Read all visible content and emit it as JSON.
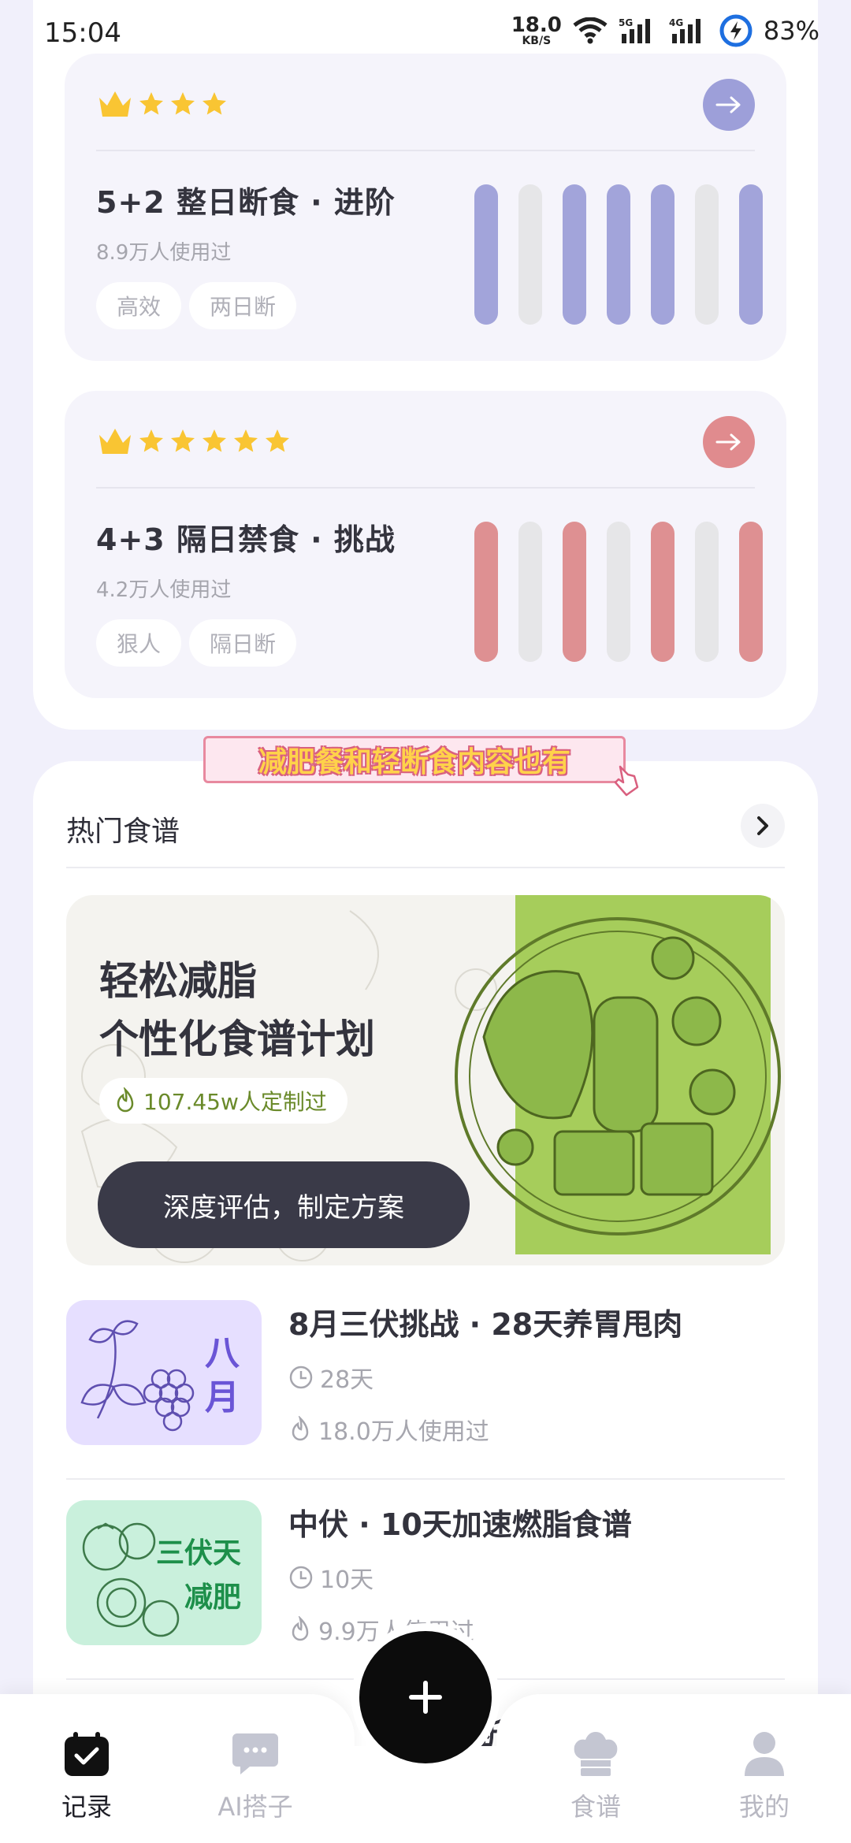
{
  "status_bar": {
    "time": "15:04",
    "net_speed": "18.0",
    "net_unit": "KB/S",
    "sig5g": "5G",
    "sig4g": "4G",
    "battery": "83%"
  },
  "plans": [
    {
      "crowns": 1,
      "stars": 3,
      "title": "5+2 整日断食 · 进阶",
      "users": "8.9万人使用过",
      "tags": [
        "高效",
        "两日断"
      ],
      "accent": "#a2a4da",
      "fast_days": [
        1,
        0,
        1,
        1,
        1,
        0,
        1
      ]
    },
    {
      "crowns": 1,
      "stars": 5,
      "title": "4+3 隔日禁食 · 挑战",
      "users": "4.2万人使用过",
      "tags": [
        "狠人",
        "隔日断"
      ],
      "accent": "#de9092",
      "fast_days": [
        1,
        0,
        1,
        0,
        1,
        0,
        1
      ]
    }
  ],
  "sticker_text": "减肥餐和轻断食内容也有",
  "recipes_section": {
    "title": "热门食谱",
    "hero": {
      "title_line1": "轻松减脂",
      "title_line2": "个性化食谱计划",
      "badge": "107.45w人定制过",
      "button": "深度评估，制定方案"
    },
    "items": [
      {
        "title": "8月三伏挑战 · 28天养胃甩肉",
        "duration": "28天",
        "users": "18.0万人使用过",
        "thumb_text": "八月",
        "thumb_icon": "lily-grape-icon"
      },
      {
        "title": "中伏 · 10天加速燃脂食谱",
        "duration": "10天",
        "users": "9.9万人使用过",
        "thumb_text_1": "三伏天",
        "thumb_text_2": "减肥",
        "thumb_icon": "tomato-cucumber-icon"
      }
    ],
    "peek_text": "断"
  },
  "bottom_nav": {
    "items": [
      {
        "label": "记录",
        "icon": "calendar-check-icon",
        "active": true
      },
      {
        "label": "AI搭子",
        "icon": "chat-bubble-icon",
        "active": false
      },
      {
        "label": "食谱",
        "icon": "chef-hat-icon",
        "active": false
      },
      {
        "label": "我的",
        "icon": "person-icon",
        "active": false
      }
    ],
    "fab_icon": "plus-icon"
  }
}
